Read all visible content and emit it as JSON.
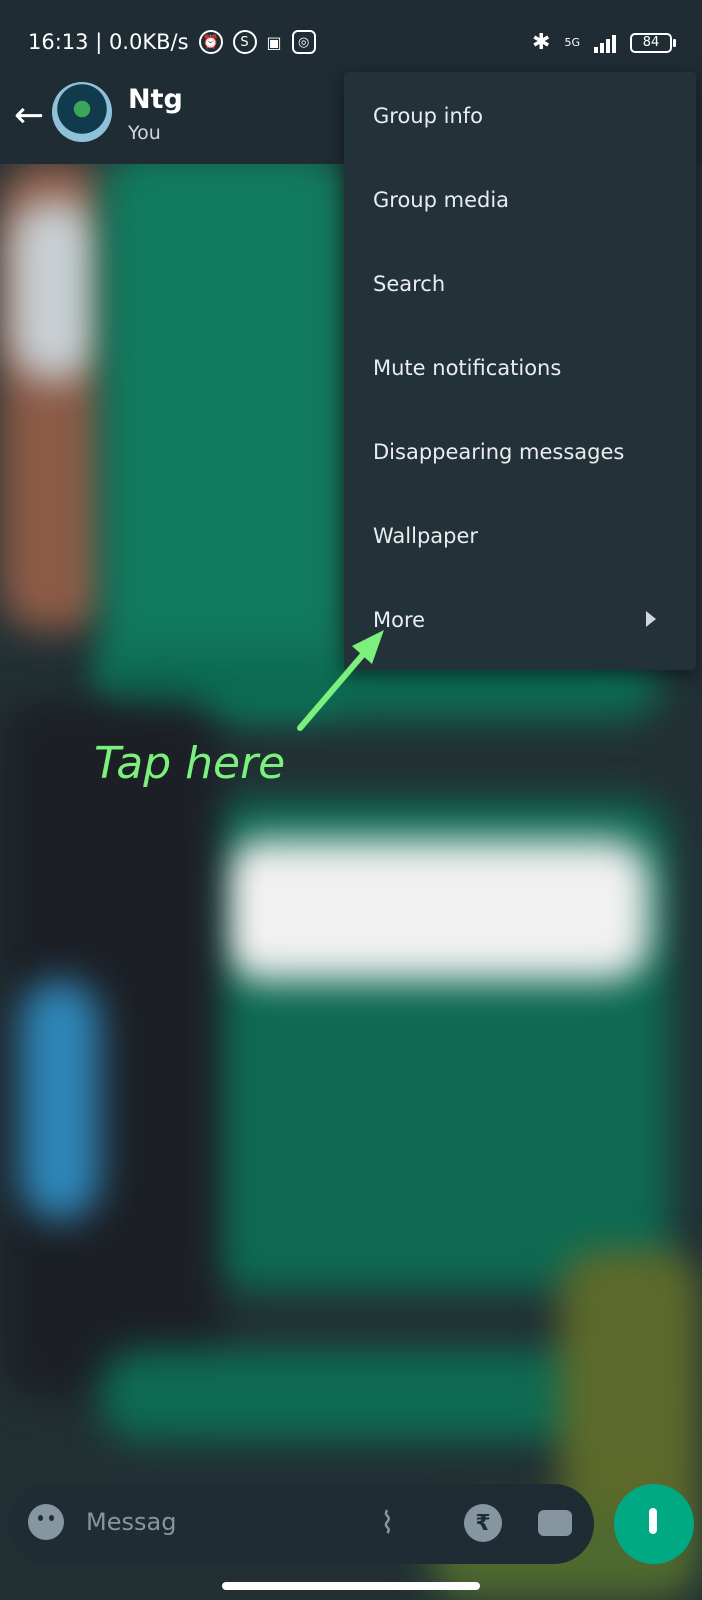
{
  "status_bar": {
    "time_speed": "16:13 | 0.0KB/s",
    "network": "5G",
    "battery": "84"
  },
  "chat_header": {
    "title": "Ntg",
    "subtitle": "You"
  },
  "menu": {
    "items": [
      {
        "label": "Group info"
      },
      {
        "label": "Group media"
      },
      {
        "label": "Search"
      },
      {
        "label": "Mute notifications"
      },
      {
        "label": "Disappearing messages"
      },
      {
        "label": "Wallpaper"
      },
      {
        "label": "More"
      }
    ]
  },
  "annotation": {
    "text": "Tap here",
    "color": "#7cf07c"
  },
  "composer": {
    "placeholder": "Messag"
  },
  "colors": {
    "appbar": "#1f2c33",
    "menu": "#233138",
    "accent": "#00a884"
  }
}
